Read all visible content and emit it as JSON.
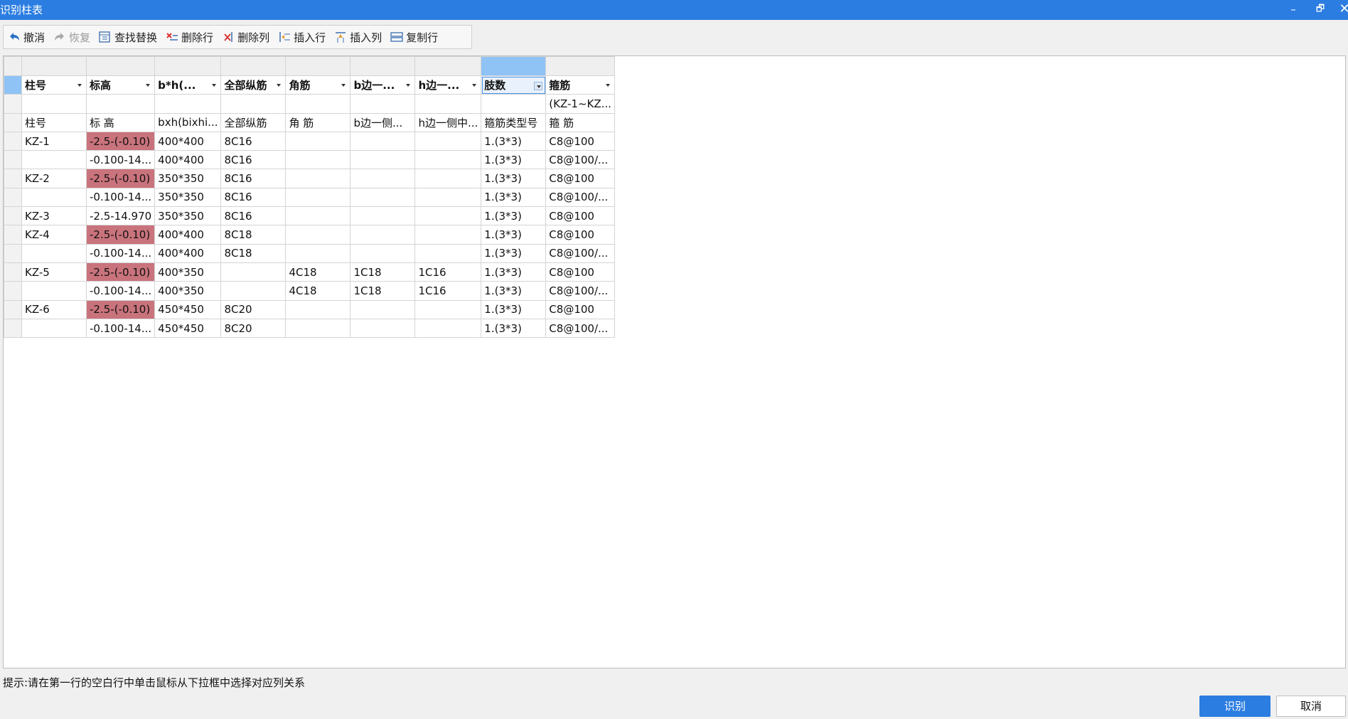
{
  "window": {
    "title": "识别柱表",
    "controls": {
      "minimize": "–",
      "restore": "🗗",
      "close": "✕"
    }
  },
  "toolbar": {
    "undo": "撤消",
    "redo": "恢复",
    "find_replace": "查找替换",
    "delete_row": "删除行",
    "delete_column": "删除列",
    "insert_row": "插入行",
    "insert_column": "插入列",
    "copy_row": "复制行"
  },
  "grid": {
    "column_mapping": [
      "柱号",
      "标高",
      "b*h(...",
      "全部纵筋",
      "角筋",
      "b边一...",
      "h边一...",
      "肢数",
      "箍筋"
    ],
    "scope_row": [
      "",
      "",
      "",
      "",
      "",
      "",
      "",
      "",
      "(KZ-1~KZ..."
    ],
    "source_header": [
      "柱号",
      "标 高",
      "bxh(bixhi...",
      "全部纵筋",
      "角 筋",
      "b边一侧...",
      "h边一侧中...",
      "箍筋类型号",
      "箍 筋"
    ],
    "rows": [
      [
        "KZ-1",
        "-2.5-(-0.10)",
        "400*400",
        "8C16",
        "",
        "",
        "",
        "1.(3*3)",
        "C8@100"
      ],
      [
        "",
        "-0.100-14...",
        "400*400",
        "8C16",
        "",
        "",
        "",
        "1.(3*3)",
        "C8@100/..."
      ],
      [
        "KZ-2",
        "-2.5-(-0.10)",
        "350*350",
        "8C16",
        "",
        "",
        "",
        "1.(3*3)",
        "C8@100"
      ],
      [
        "",
        "-0.100-14...",
        "350*350",
        "8C16",
        "",
        "",
        "",
        "1.(3*3)",
        "C8@100/..."
      ],
      [
        "KZ-3",
        "-2.5-14.970",
        "350*350",
        "8C16",
        "",
        "",
        "",
        "1.(3*3)",
        "C8@100"
      ],
      [
        "KZ-4",
        "-2.5-(-0.10)",
        "400*400",
        "8C18",
        "",
        "",
        "",
        "1.(3*3)",
        "C8@100"
      ],
      [
        "",
        "-0.100-14...",
        "400*400",
        "8C18",
        "",
        "",
        "",
        "1.(3*3)",
        "C8@100/..."
      ],
      [
        "KZ-5",
        "-2.5-(-0.10)",
        "400*350",
        "",
        "4C18",
        "1C18",
        "1C16",
        "1.(3*3)",
        "C8@100"
      ],
      [
        "",
        "-0.100-14...",
        "400*350",
        "",
        "4C18",
        "1C18",
        "1C16",
        "1.(3*3)",
        "C8@100/..."
      ],
      [
        "KZ-6",
        "-2.5-(-0.10)",
        "450*450",
        "8C20",
        "",
        "",
        "",
        "1.(3*3)",
        "C8@100"
      ],
      [
        "",
        "-0.100-14...",
        "450*450",
        "8C20",
        "",
        "",
        "",
        "1.(3*3)",
        "C8@100/..."
      ]
    ],
    "highlighted_rows": [
      0,
      2,
      5,
      7,
      9
    ],
    "highlight_color": "#c9737c",
    "selected_column": 7
  },
  "hint": "提示:请在第一行的空白行中单击鼠标从下拉框中选择对应列关系",
  "buttons": {
    "ok": "识别",
    "cancel": "取消"
  },
  "colors": {
    "accent": "#2b7de1",
    "selection": "#8fc3f5"
  },
  "icons": [
    "undo-icon",
    "redo-icon",
    "find-replace-icon",
    "delete-row-icon",
    "delete-column-icon",
    "insert-row-icon",
    "insert-column-icon",
    "copy-row-icon"
  ]
}
